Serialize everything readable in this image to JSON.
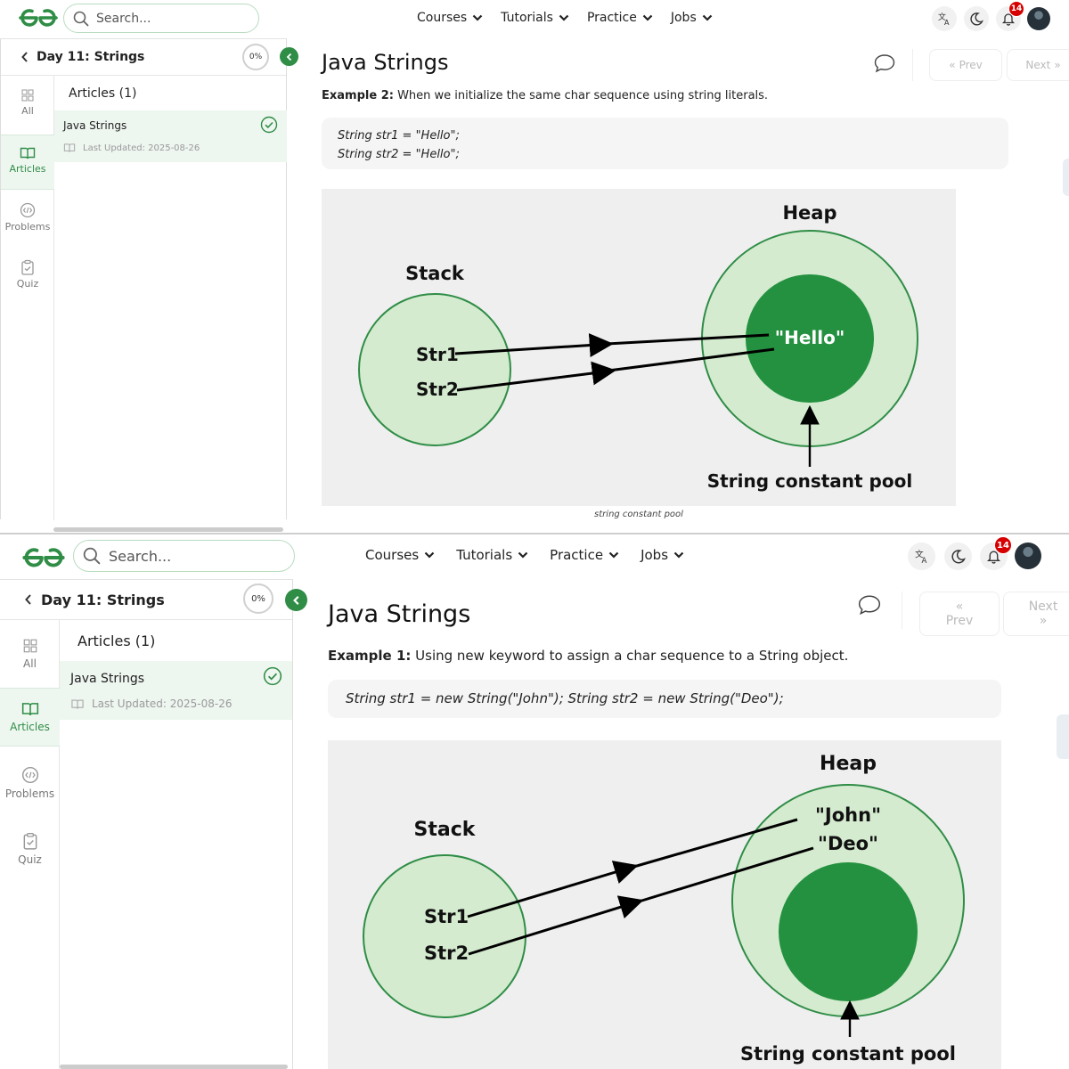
{
  "top_nav": {
    "search_placeholder": "Search...",
    "menu": [
      "Courses",
      "Tutorials",
      "Practice",
      "Jobs"
    ],
    "notification_count": "14"
  },
  "sidebar": {
    "title": "Day 11: Strings",
    "progress": "0%",
    "rail": [
      "All",
      "Articles",
      "Problems",
      "Quiz"
    ],
    "list_heading": "Articles (1)",
    "article_title": "Java Strings",
    "article_meta": "Last Updated: 2025-08-26"
  },
  "article": {
    "title": "Java Strings",
    "prev_label": "Prev",
    "next_label": "Next"
  },
  "screens": [
    {
      "example_label": "Example 2:",
      "example_text": " When we initialize the same char sequence using string literals.",
      "code_lines": [
        "String str1 = \"Hello\";",
        "String str2 = \"Hello\";"
      ],
      "diagram": {
        "heap_label": "Heap",
        "stack_label": "Stack",
        "var1": "Str1",
        "var2": "Str2",
        "pool_value": "\"Hello\"",
        "pool_label": "String constant pool"
      },
      "caption": "string constant pool"
    },
    {
      "example_label": "Example 1:",
      "example_text": " Using new keyword to assign a char sequence to a String object.",
      "code_lines": [
        "String str1 = new String(\"John\"); String str2 = new String(\"Deo\");"
      ],
      "diagram": {
        "heap_label": "Heap",
        "stack_label": "Stack",
        "var1": "Str1",
        "var2": "Str2",
        "heap_value1": "\"John\"",
        "heap_value2": "\"Deo\"",
        "pool_label": "String constant pool"
      }
    }
  ],
  "colors": {
    "brand_green": "#2f8d46",
    "light_green": "#d4ebcf",
    "dark_green": "#23913f",
    "badge_red": "#d60000"
  }
}
